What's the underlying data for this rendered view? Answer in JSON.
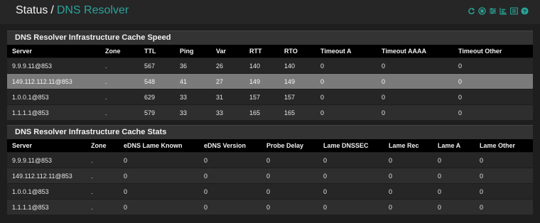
{
  "header": {
    "crumb_root": "Status",
    "crumb_sep": "/",
    "crumb_current": "DNS Resolver",
    "accent": "#2aa39a",
    "icons": [
      "reload-icon",
      "stop-icon",
      "sliders-icon",
      "bar-chart-icon",
      "list-icon",
      "help-icon"
    ]
  },
  "speed": {
    "title": "DNS Resolver Infrastructure Cache Speed",
    "columns": [
      "Server",
      "Zone",
      "TTL",
      "Ping",
      "Var",
      "RTT",
      "RTO",
      "Timeout A",
      "Timeout AAAA",
      "Timeout Other"
    ],
    "rows": [
      [
        "9.9.9.11@853",
        ".",
        "567",
        "36",
        "26",
        "140",
        "140",
        "0",
        "0",
        "0"
      ],
      [
        "149.112.112.11@853",
        ".",
        "548",
        "41",
        "27",
        "149",
        "149",
        "0",
        "0",
        "0"
      ],
      [
        "1.0.0.1@853",
        ".",
        "629",
        "33",
        "31",
        "157",
        "157",
        "0",
        "0",
        "0"
      ],
      [
        "1.1.1.1@853",
        ".",
        "579",
        "33",
        "33",
        "165",
        "165",
        "0",
        "0",
        "0"
      ]
    ]
  },
  "stats": {
    "title": "DNS Resolver Infrastructure Cache Stats",
    "columns": [
      "Server",
      "Zone",
      "eDNS Lame Known",
      "eDNS Version",
      "Probe Delay",
      "Lame DNSSEC",
      "Lame Rec",
      "Lame A",
      "Lame Other"
    ],
    "rows": [
      [
        "9.9.9.11@853",
        ".",
        "0",
        "0",
        "0",
        "0",
        "0",
        "0",
        "0"
      ],
      [
        "149.112.112.11@853",
        ".",
        "0",
        "0",
        "0",
        "0",
        "0",
        "0",
        "0"
      ],
      [
        "1.0.0.1@853",
        ".",
        "0",
        "0",
        "0",
        "0",
        "0",
        "0",
        "0"
      ],
      [
        "1.1.1.1@853",
        ".",
        "0",
        "0",
        "0",
        "0",
        "0",
        "0",
        "0"
      ]
    ]
  }
}
